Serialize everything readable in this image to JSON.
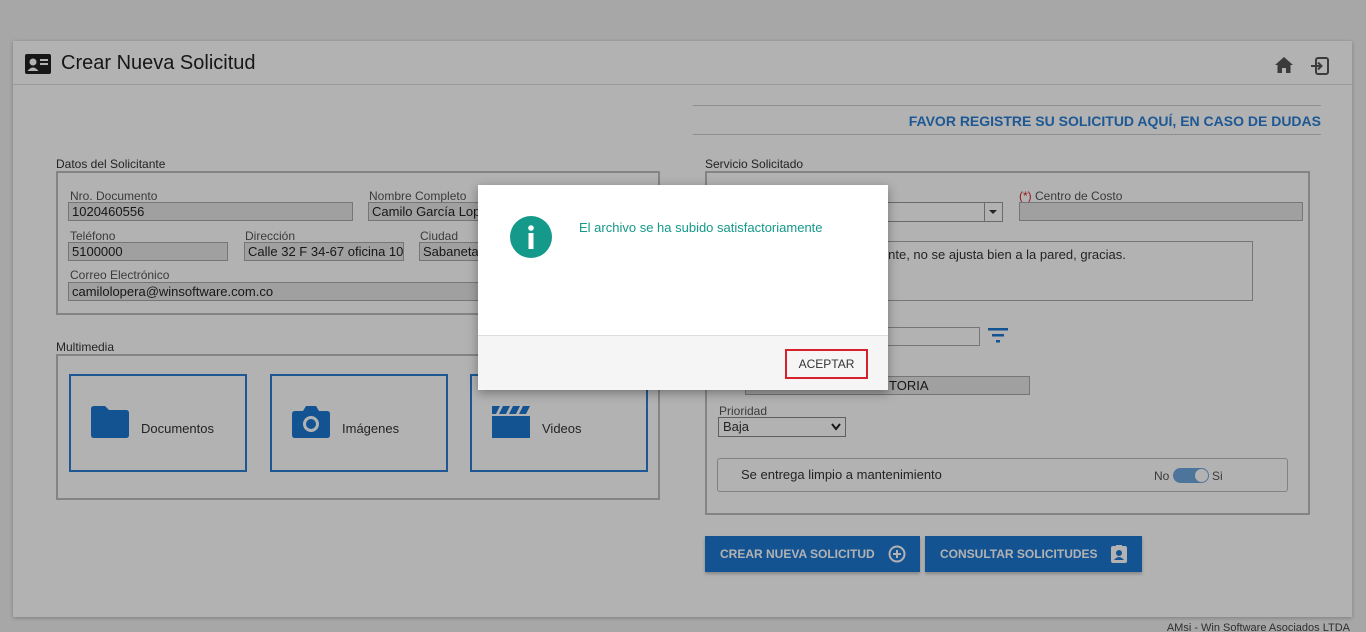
{
  "window": {
    "title": "Crear Nueva Solicitud"
  },
  "header": {
    "icons": [
      "id-card-icon",
      "home-icon",
      "exit-icon"
    ]
  },
  "banner": {
    "text": "FAVOR REGISTRE SU SOLICITUD AQUÍ, EN CASO DE DUDAS"
  },
  "applicant": {
    "legend": "Datos del Solicitante",
    "doc_label": "Nro. Documento",
    "doc_value": "1020460556",
    "name_label": "Nombre Completo",
    "name_value": "Camilo García Lop",
    "phone_label": "Teléfono",
    "phone_value": "5100000",
    "address_label": "Dirección",
    "address_value": "Calle 32 F 34-67 oficina 10",
    "city_label": "Ciudad",
    "city_value": "Sabaneta",
    "email_label": "Correo Electrónico",
    "email_value": "camilolopera@winsoftware.com.co"
  },
  "multimedia": {
    "legend": "Multimedia",
    "documents": "Documentos",
    "images": "Imágenes",
    "videos": "Videos"
  },
  "service": {
    "legend": "Servicio Solicitado",
    "cost_center_req": "(*)",
    "cost_center_label": " Centro de Costo",
    "description_value": "iente, no se ajusta bien a la pared, gracias.",
    "area_value": "TORIA",
    "priority_label": "Prioridad",
    "priority_value": "Baja",
    "clean_label": "Se entrega limpio a mantenimiento",
    "toggle_no": "No",
    "toggle_si": "Si"
  },
  "actions": {
    "create": "CREAR NUEVA SOLICITUD",
    "consult": "CONSULTAR SOLICITUDES"
  },
  "footer": {
    "text": "AMsi - Win Software Asociados LTDA"
  },
  "modal": {
    "message": "El archivo se ha subido satisfactoriamente",
    "accept": "ACEPTAR"
  },
  "colors": {
    "accent": "#1e78d2",
    "info": "#14998a",
    "focus_border": "#d6202a"
  }
}
